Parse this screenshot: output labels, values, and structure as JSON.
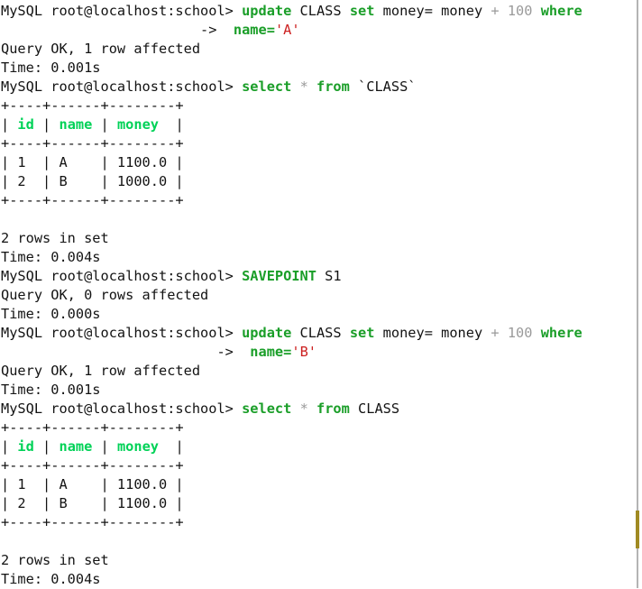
{
  "terminal": {
    "prompt": "MySQL root@localhost:school>",
    "continuation_prompt": "->",
    "background_color": "#ffffff",
    "text_color": "#131313",
    "keyword_color": "#1a9e28",
    "header_color": "#00d257",
    "string_color": "#cc2020",
    "operator_color": "#9a9a9a"
  },
  "scrollbar": {
    "track_color": "#b4b4b4",
    "thumb_color": "#a08a22"
  },
  "lines": [
    {
      "id": "cmd-update-a",
      "tokens": [
        {
          "t": "MySQL root@localhost:school> ",
          "c": "plain"
        },
        {
          "t": "update",
          "c": "kw"
        },
        {
          "t": " CLASS ",
          "c": "plain"
        },
        {
          "t": "set",
          "c": "kw"
        },
        {
          "t": " money= money ",
          "c": "plain"
        },
        {
          "t": "+",
          "c": "op"
        },
        {
          "t": " ",
          "c": "plain"
        },
        {
          "t": "100",
          "c": "num"
        },
        {
          "t": " ",
          "c": "plain"
        },
        {
          "t": "where",
          "c": "kw"
        }
      ]
    },
    {
      "id": "cont-update-a",
      "tokens": [
        {
          "t": "                        ",
          "c": "plain"
        },
        {
          "t": "->",
          "c": "cont"
        },
        {
          "t": "  ",
          "c": "plain"
        },
        {
          "t": "name=",
          "c": "kw"
        },
        {
          "t": "'A'",
          "c": "str"
        }
      ]
    },
    {
      "id": "result-update-a",
      "tokens": [
        {
          "t": "Query OK, 1 row affected",
          "c": "plain"
        }
      ]
    },
    {
      "id": "time-update-a",
      "tokens": [
        {
          "t": "Time: 0.001s",
          "c": "plain"
        }
      ]
    },
    {
      "id": "cmd-select-1",
      "tokens": [
        {
          "t": "MySQL root@localhost:school> ",
          "c": "plain"
        },
        {
          "t": "select",
          "c": "kw"
        },
        {
          "t": " ",
          "c": "plain"
        },
        {
          "t": "*",
          "c": "op"
        },
        {
          "t": " ",
          "c": "plain"
        },
        {
          "t": "from",
          "c": "kw"
        },
        {
          "t": " `CLASS`",
          "c": "plain"
        }
      ]
    },
    {
      "id": "table1-border-top",
      "tokens": [
        {
          "t": "+----+------+--------+",
          "c": "plain"
        }
      ]
    },
    {
      "id": "table1-header",
      "tokens": [
        {
          "t": "| ",
          "c": "plain"
        },
        {
          "t": "id",
          "c": "hdr"
        },
        {
          "t": " | ",
          "c": "plain"
        },
        {
          "t": "name",
          "c": "hdr"
        },
        {
          "t": " | ",
          "c": "plain"
        },
        {
          "t": "money",
          "c": "hdr"
        },
        {
          "t": "  |",
          "c": "plain"
        }
      ]
    },
    {
      "id": "table1-border-mid",
      "tokens": [
        {
          "t": "+----+------+--------+",
          "c": "plain"
        }
      ]
    },
    {
      "id": "table1-row-1",
      "tokens": [
        {
          "t": "| 1  | A    | 1100.0 |",
          "c": "plain"
        }
      ]
    },
    {
      "id": "table1-row-2",
      "tokens": [
        {
          "t": "| 2  | B    | 1000.0 |",
          "c": "plain"
        }
      ]
    },
    {
      "id": "table1-border-bottom",
      "tokens": [
        {
          "t": "+----+------+--------+",
          "c": "plain"
        }
      ]
    },
    {
      "id": "blank-1",
      "tokens": [
        {
          "t": "",
          "c": "plain"
        }
      ]
    },
    {
      "id": "rows-in-set-1",
      "tokens": [
        {
          "t": "2 rows in set",
          "c": "plain"
        }
      ]
    },
    {
      "id": "time-select-1",
      "tokens": [
        {
          "t": "Time: 0.004s",
          "c": "plain"
        }
      ]
    },
    {
      "id": "cmd-savepoint",
      "tokens": [
        {
          "t": "MySQL root@localhost:school> ",
          "c": "plain"
        },
        {
          "t": "SAVEPOINT",
          "c": "kw"
        },
        {
          "t": " S1",
          "c": "plain"
        }
      ]
    },
    {
      "id": "result-savepoint",
      "tokens": [
        {
          "t": "Query OK, 0 rows affected",
          "c": "plain"
        }
      ]
    },
    {
      "id": "time-savepoint",
      "tokens": [
        {
          "t": "Time: 0.000s",
          "c": "plain"
        }
      ]
    },
    {
      "id": "cmd-update-b",
      "tokens": [
        {
          "t": "MySQL root@localhost:school> ",
          "c": "plain"
        },
        {
          "t": "update",
          "c": "kw"
        },
        {
          "t": " CLASS ",
          "c": "plain"
        },
        {
          "t": "set",
          "c": "kw"
        },
        {
          "t": " money= money ",
          "c": "plain"
        },
        {
          "t": "+",
          "c": "op"
        },
        {
          "t": " ",
          "c": "plain"
        },
        {
          "t": "100",
          "c": "num"
        },
        {
          "t": " ",
          "c": "plain"
        },
        {
          "t": "where",
          "c": "kw"
        }
      ]
    },
    {
      "id": "cont-update-b",
      "tokens": [
        {
          "t": "                          ",
          "c": "plain"
        },
        {
          "t": "->",
          "c": "cont"
        },
        {
          "t": "  ",
          "c": "plain"
        },
        {
          "t": "name=",
          "c": "kw"
        },
        {
          "t": "'B'",
          "c": "str"
        }
      ]
    },
    {
      "id": "result-update-b",
      "tokens": [
        {
          "t": "Query OK, 1 row affected",
          "c": "plain"
        }
      ]
    },
    {
      "id": "time-update-b",
      "tokens": [
        {
          "t": "Time: 0.001s",
          "c": "plain"
        }
      ]
    },
    {
      "id": "cmd-select-2",
      "tokens": [
        {
          "t": "MySQL root@localhost:school> ",
          "c": "plain"
        },
        {
          "t": "select",
          "c": "kw"
        },
        {
          "t": " ",
          "c": "plain"
        },
        {
          "t": "*",
          "c": "op"
        },
        {
          "t": " ",
          "c": "plain"
        },
        {
          "t": "from",
          "c": "kw"
        },
        {
          "t": " CLASS",
          "c": "plain"
        }
      ]
    },
    {
      "id": "table2-border-top",
      "tokens": [
        {
          "t": "+----+------+--------+",
          "c": "plain"
        }
      ]
    },
    {
      "id": "table2-header",
      "tokens": [
        {
          "t": "| ",
          "c": "plain"
        },
        {
          "t": "id",
          "c": "hdr"
        },
        {
          "t": " | ",
          "c": "plain"
        },
        {
          "t": "name",
          "c": "hdr"
        },
        {
          "t": " | ",
          "c": "plain"
        },
        {
          "t": "money",
          "c": "hdr"
        },
        {
          "t": "  |",
          "c": "plain"
        }
      ]
    },
    {
      "id": "table2-border-mid",
      "tokens": [
        {
          "t": "+----+------+--------+",
          "c": "plain"
        }
      ]
    },
    {
      "id": "table2-row-1",
      "tokens": [
        {
          "t": "| 1  | A    | 1100.0 |",
          "c": "plain"
        }
      ]
    },
    {
      "id": "table2-row-2",
      "tokens": [
        {
          "t": "| 2  | B    | 1100.0 |",
          "c": "plain"
        }
      ]
    },
    {
      "id": "table2-border-bottom",
      "tokens": [
        {
          "t": "+----+------+--------+",
          "c": "plain"
        }
      ]
    },
    {
      "id": "blank-2",
      "tokens": [
        {
          "t": "",
          "c": "plain"
        }
      ]
    },
    {
      "id": "rows-in-set-2",
      "tokens": [
        {
          "t": "2 rows in set",
          "c": "plain"
        }
      ]
    },
    {
      "id": "time-select-2",
      "tokens": [
        {
          "t": "Time: 0.004s",
          "c": "plain"
        }
      ]
    }
  ]
}
